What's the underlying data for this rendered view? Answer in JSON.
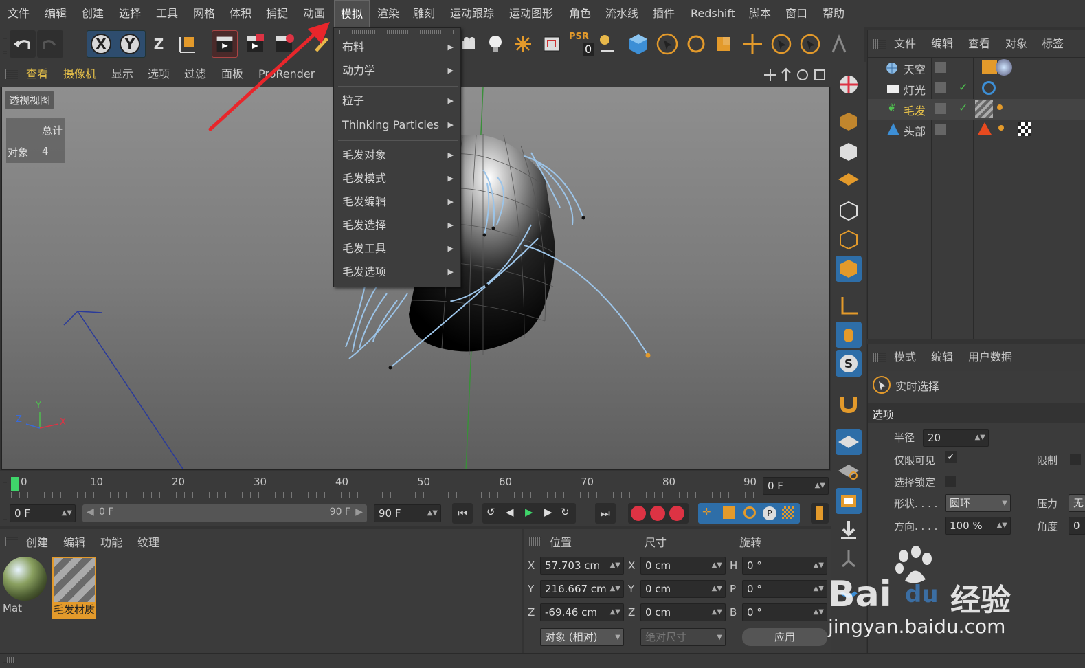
{
  "menubar": {
    "items": [
      "文件",
      "编辑",
      "创建",
      "选择",
      "工具",
      "网格",
      "体积",
      "捕捉",
      "动画",
      "模拟",
      "渲染",
      "雕刻",
      "运动跟踪",
      "运动图形",
      "角色",
      "流水线",
      "插件",
      "Redshift",
      "脚本",
      "窗口",
      "帮助"
    ],
    "active": "模拟"
  },
  "dropdown": {
    "items": [
      {
        "label": "布料",
        "submenu": true
      },
      {
        "label": "动力学",
        "submenu": true
      },
      {
        "label": "粒子",
        "submenu": true
      },
      {
        "label": "Thinking Particles",
        "submenu": true
      },
      {
        "label": "毛发对象",
        "submenu": true
      },
      {
        "label": "毛发模式",
        "submenu": true
      },
      {
        "label": "毛发编辑",
        "submenu": true
      },
      {
        "label": "毛发选择",
        "submenu": true
      },
      {
        "label": "毛发工具",
        "submenu": true
      },
      {
        "label": "毛发选项",
        "submenu": true
      }
    ]
  },
  "toolbar": {
    "axis_x": "X",
    "axis_y": "Y",
    "axis_z": "Z",
    "psr_label": "PSR",
    "psr_value": "0"
  },
  "viewport": {
    "menu": [
      "查看",
      "摄像机",
      "显示",
      "选项",
      "过滤",
      "面板",
      "ProRender"
    ],
    "view_name": "透视视图",
    "stats_title": "总计",
    "stats_label": "对象",
    "stats_value": "4",
    "axis_labels": {
      "x": "X",
      "y": "Y",
      "z": "Z"
    }
  },
  "object_manager": {
    "menu": [
      "文件",
      "编辑",
      "查看",
      "对象",
      "标签"
    ],
    "objects": [
      {
        "name": "天空",
        "icon": "sky-icon",
        "color": "#c8c8c8"
      },
      {
        "name": "灯光",
        "icon": "light-icon",
        "color": "#c8c8c8"
      },
      {
        "name": "毛发",
        "icon": "hair-icon",
        "color": "#e7c14a"
      },
      {
        "name": "头部",
        "icon": "head-icon",
        "color": "#c8c8c8"
      }
    ]
  },
  "attribute_manager": {
    "menu": [
      "模式",
      "编辑",
      "用户数据"
    ],
    "tool_name": "实时选择",
    "section": "选项",
    "radius_label": "半径",
    "radius_value": "20",
    "visible_only_label": "仅限可见",
    "visible_only_check": "✓",
    "limit_label": "限制",
    "select_lock_label": "选择锁定",
    "shape_label": "形状. . . .",
    "shape_value": "圆环",
    "pressure_label": "压力",
    "pressure_value": "无",
    "direction_label": "方向. . . .",
    "direction_value": "100 %",
    "angle_label": "角度",
    "angle_value": "0"
  },
  "timeline": {
    "ticks": [
      "0",
      "10",
      "20",
      "30",
      "40",
      "50",
      "60",
      "70",
      "80",
      "90"
    ],
    "current_frame": "0 F"
  },
  "playback": {
    "start": "0 F",
    "range_start": "0 F",
    "range_end": "90 F",
    "end": "90 F"
  },
  "material_manager": {
    "menu": [
      "创建",
      "编辑",
      "功能",
      "纹理"
    ],
    "materials": [
      {
        "name": "Mat"
      },
      {
        "name": "毛发材质"
      }
    ]
  },
  "coordinates": {
    "headers": [
      "位置",
      "尺寸",
      "旋转"
    ],
    "rows": [
      {
        "axis": "X",
        "pos": "57.703 cm",
        "size_axis": "X",
        "size": "0 cm",
        "rot_axis": "H",
        "rot": "0 °"
      },
      {
        "axis": "Y",
        "pos": "216.667 cm",
        "size_axis": "Y",
        "size": "0 cm",
        "rot_axis": "P",
        "rot": "0 °"
      },
      {
        "axis": "Z",
        "pos": "-69.46 cm",
        "size_axis": "Z",
        "size": "0 cm",
        "rot_axis": "B",
        "rot": "0 °"
      }
    ],
    "mode": "对象 (相对)",
    "size_mode": "绝对尺寸",
    "apply": "应用"
  },
  "watermark": {
    "text1": "Bai",
    "text2": "du",
    "text3": "经验",
    "url": "jingyan.baidu.com"
  },
  "colors": {
    "accent_blue": "#2e6ea8",
    "highlight_yellow": "#e7c14a",
    "arrow_red": "#e8262b",
    "hair_blue": "#9cc4e8"
  }
}
